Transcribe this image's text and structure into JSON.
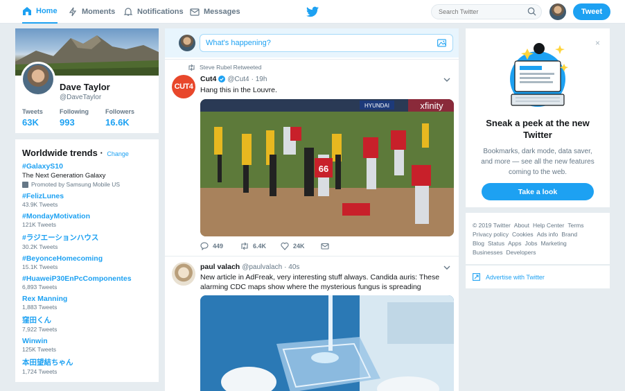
{
  "nav": {
    "home": "Home",
    "moments": "Moments",
    "notifications": "Notifications",
    "messages": "Messages",
    "search_placeholder": "Search Twitter",
    "tweet_button": "Tweet"
  },
  "profile": {
    "name": "Dave Taylor",
    "handle": "@DaveTaylor",
    "stats": [
      {
        "label": "Tweets",
        "value": "63K"
      },
      {
        "label": "Following",
        "value": "993"
      },
      {
        "label": "Followers",
        "value": "16.6K"
      }
    ]
  },
  "trends": {
    "title": "Worldwide trends",
    "change": "Change",
    "promoted": {
      "name": "#GalaxyS10",
      "desc": "The Next Generation Galaxy",
      "promo": "Promoted by Samsung Mobile US"
    },
    "items": [
      {
        "name": "#FelizLunes",
        "count": "43.9K Tweets"
      },
      {
        "name": "#MondayMotivation",
        "count": "121K Tweets"
      },
      {
        "name": "#ラジエーションハウス",
        "count": "30.2K Tweets"
      },
      {
        "name": "#BeyonceHomecoming",
        "count": "15.1K Tweets"
      },
      {
        "name": "#HuaweiP30EnPcComponentes",
        "count": "6,893 Tweets"
      },
      {
        "name": "Rex Manning",
        "count": "1,883 Tweets"
      },
      {
        "name": "窪田くん",
        "count": "7,922 Tweets"
      },
      {
        "name": "Winwin",
        "count": "125K Tweets"
      },
      {
        "name": "本田望結ちゃん",
        "count": "1,724 Tweets"
      }
    ]
  },
  "composer": {
    "placeholder": "What's happening?"
  },
  "tweets": [
    {
      "retweeted_by": "Steve Rubel Retweeted",
      "avatar_text": "CUT4",
      "name": "Cut4",
      "handle": "@Cut4",
      "time": "· 19h",
      "text": "Hang this in the Louvre.",
      "replies": "449",
      "retweets": "6.4K",
      "likes": "24K"
    },
    {
      "name": "paul valach",
      "handle": "@paulvalach",
      "time": "· 40s",
      "text": "New article in AdFreak, very interesting stuff always. Candida auris: These alarming CDC maps show where the mysterious fungus is spreading"
    }
  ],
  "peek": {
    "title": "Sneak a peek at the new Twitter",
    "desc": "Bookmarks, dark mode, data saver, and more — see all the new features coming to the web.",
    "button": "Take a look",
    "close": "×"
  },
  "footer": {
    "links": [
      "© 2019 Twitter",
      "About",
      "Help Center",
      "Terms",
      "Privacy policy",
      "Cookies",
      "Ads info",
      "Brand",
      "Blog",
      "Status",
      "Apps",
      "Jobs",
      "Marketing",
      "Businesses",
      "Developers"
    ]
  },
  "advertise": "Advertise with Twitter",
  "media_text": {
    "xfinity": "xfinity",
    "hyundai": "HYUNDAI",
    "jersey": "66"
  },
  "colors": {
    "accent": "#1da1f2",
    "background": "#e6ecf0"
  }
}
